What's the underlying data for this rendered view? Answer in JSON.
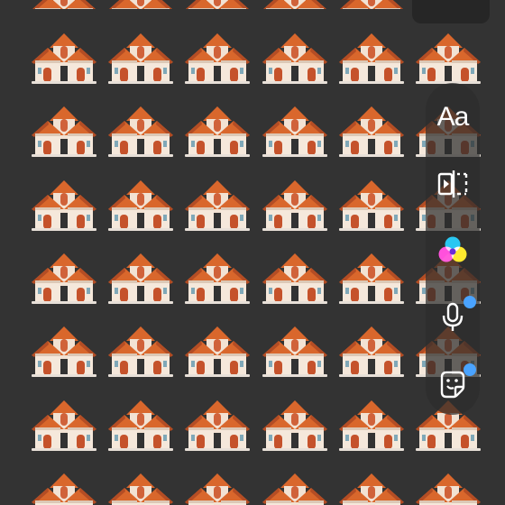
{
  "wallpaper": {
    "icon": "house-emoji-icon",
    "rows": 7,
    "columns": 6
  },
  "toolbar": {
    "text_tool_label": "Aa",
    "items": [
      {
        "name": "text-tool",
        "icon": "text-aa-icon"
      },
      {
        "name": "mirror-tool",
        "icon": "mirror-split-icon"
      },
      {
        "name": "color-tool",
        "icon": "color-circles-icon"
      },
      {
        "name": "microphone-tool",
        "icon": "microphone-icon",
        "badge": true
      },
      {
        "name": "sticker-tool",
        "icon": "sticker-face-icon",
        "badge": true
      }
    ]
  },
  "colors": {
    "background": "#333333",
    "badge": "#4aa3ff",
    "roof": "#d9672c",
    "wall": "#f2e2d3",
    "door": "#c5522b"
  }
}
